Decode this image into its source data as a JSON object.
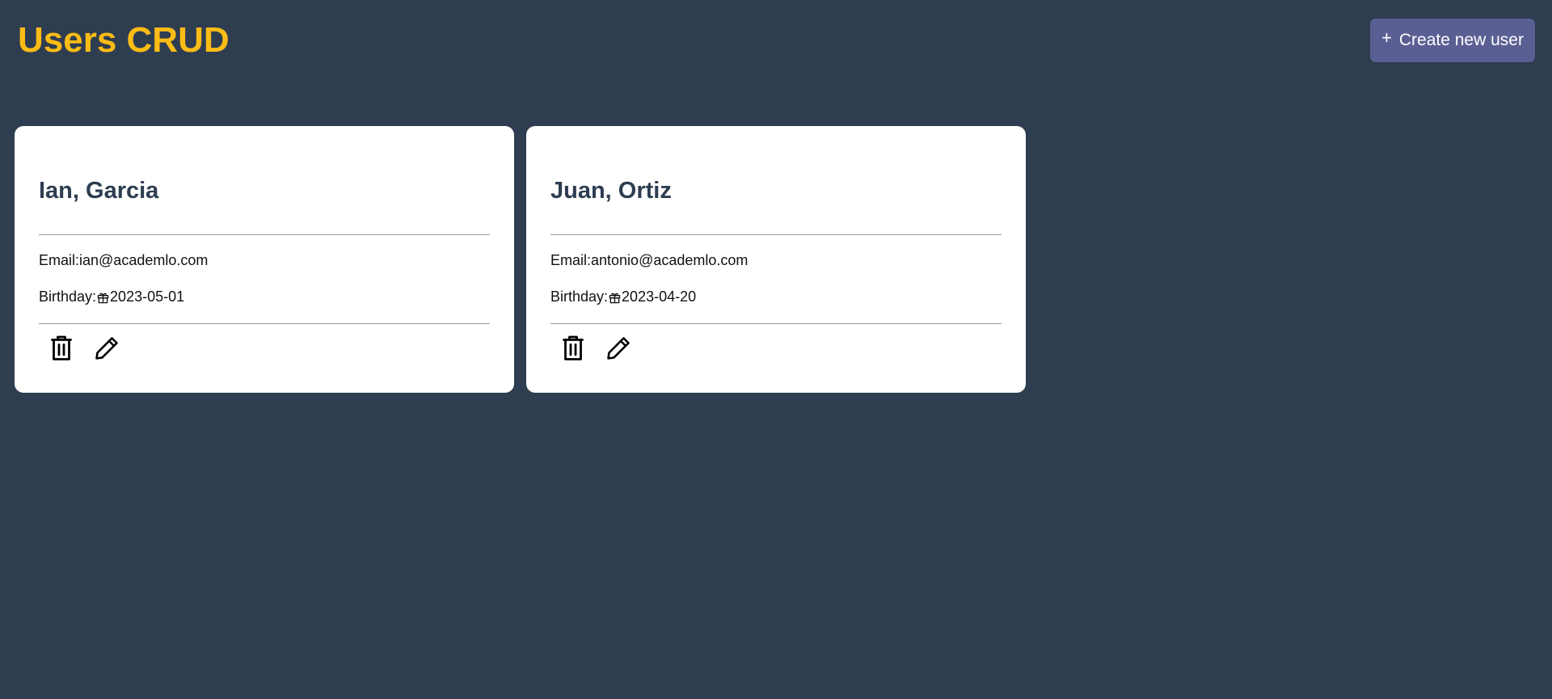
{
  "header": {
    "title": "Users CRUD",
    "create_button_label": "Create new user",
    "create_button_icon": "plus-icon"
  },
  "colors": {
    "background": "#2e3d50",
    "title": "#fcbc15",
    "button": "#5a5f93",
    "card": "#ffffff",
    "name": "#2e3d50"
  },
  "users": [
    {
      "name": "Ian, Garcia",
      "email_label": "Email:",
      "email": "ian@academlo.com",
      "birthday_label": "Birthday:",
      "birthday_icon": "gift-icon",
      "birthday": "2023-05-01",
      "actions": [
        "trash-icon",
        "pencil-icon"
      ]
    },
    {
      "name": "Juan, Ortiz",
      "email_label": "Email:",
      "email": "antonio@academlo.com",
      "birthday_label": "Birthday:",
      "birthday_icon": "gift-icon",
      "birthday": "2023-04-20",
      "actions": [
        "trash-icon",
        "pencil-icon"
      ]
    }
  ]
}
